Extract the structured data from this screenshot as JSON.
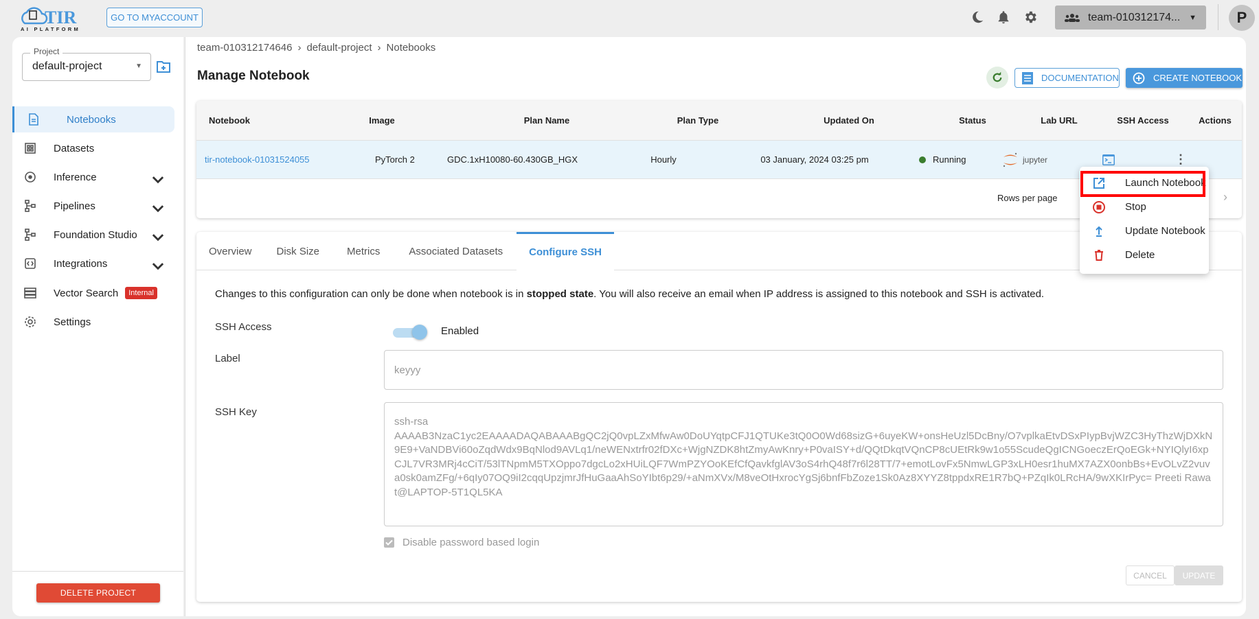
{
  "header": {
    "logo_text": "TIR",
    "logo_sub": "AI PLATFORM",
    "myaccount": "GO TO MYACCOUNT",
    "team": "team-010312174...",
    "avatar": "P",
    "icons": [
      "moon-icon",
      "bell-icon",
      "gear-icon"
    ]
  },
  "sidebar": {
    "project_label": "Project",
    "project": "default-project",
    "items": [
      {
        "label": "Notebooks",
        "icon": "notebook-icon"
      },
      {
        "label": "Datasets",
        "icon": "dataset-icon"
      },
      {
        "label": "Inference",
        "icon": "inference-icon"
      },
      {
        "label": "Pipelines",
        "icon": "pipeline-icon"
      },
      {
        "label": "Foundation Studio",
        "icon": "pipeline-icon"
      },
      {
        "label": "Integrations",
        "icon": "integration-icon"
      },
      {
        "label": "Vector Search",
        "icon": "storage-icon",
        "badge": "Internal"
      },
      {
        "label": "Settings",
        "icon": "gear-icon"
      }
    ],
    "delete_project": "DELETE PROJECT"
  },
  "breadcrumb": [
    "team-010312174646",
    "default-project",
    "Notebooks"
  ],
  "page": {
    "title": "Manage Notebook",
    "documentation": "DOCUMENTATION",
    "create": "CREATE NOTEBOOK"
  },
  "table": {
    "columns": [
      "Notebook",
      "Image",
      "Plan Name",
      "Plan Type",
      "Updated On",
      "Status",
      "Lab URL",
      "SSH Access",
      "Actions"
    ],
    "rows": [
      {
        "notebook": "tir-notebook-01031524055",
        "image": "PyTorch 2",
        "plan": "GDC.1xH10080-60.430GB_HGX",
        "type": "Hourly",
        "updated": "03 January, 2024 03:25 pm",
        "status": "Running",
        "lab": "jupyter"
      }
    ],
    "rows_per_page": "Rows per page"
  },
  "menu": {
    "items": [
      "Launch Notebook",
      "Stop",
      "Update Notebook",
      "Delete"
    ]
  },
  "tabs": [
    "Overview",
    "Disk Size",
    "Metrics",
    "Associated Datasets",
    "Configure SSH"
  ],
  "ssh": {
    "info_pre": "Changes to this configuration can only be done when notebook is in ",
    "info_bold": "stopped state",
    "info_post": ". You will also receive an email when IP address is assigned to this notebook and SSH is activated.",
    "access_label": "SSH Access",
    "access_state": "Enabled",
    "enabled": true,
    "label_label": "Label",
    "label_placeholder": "keyyy",
    "key_label": "SSH Key",
    "key_line1": "ssh-rsa",
    "key_body": "AAAAB3NzaC1yc2EAAAADAQABAAABgQC2jQ0vpLZxMfwAw0DoUYqtpCFJ1QTUKe3tQ0O0Wd68sizG+6uyeKW+onsHeUzl5DcBny/O7vplkaEtvDSxPIypBvjWZC3HyThzWjDXkN9E9+VaNDBVi60oZqdWdx9BqNlod9AVLq1/neWENxtrfr02fDXc+WjgNZDK8htZmyAwKnry+P0vaISY+d/QQtDkqtVQnCP8cUEtRk9w1o55ScudeQgICNGoeczErQoEGk+NYIQlyI6xpCJL7VR3MRj4cCiT/53lTNpmM5TXOppo7dgcLo2xHUiLQF7WmPZYOoKEfCfQavkfglAV3oS4rhQ48f7r6l28TT/7+emotLovFx5NmwLGP3xLH0esr1huMX7AZX0onbBs+EvOLvZ2vuva0sk0amZFg/+6qIy07OQ9iI2cqqUpzjmrJfHuGaaAhSoYIbt6p29/+aNmXVx/M8veOtHxrocYgSj6bnfFbZoze1Sk0Az8XYYZ8tppdxRE1R7bQ+PZqIk0LRcHA/9wXKIrPyc= Preeti Rawat@LAPTOP-5T1QL5KA",
    "disable_pw": "Disable password based login",
    "disable_pw_checked": true,
    "cancel": "CANCEL",
    "update": "UPDATE"
  },
  "colors": {
    "accent": "#3d8fd6",
    "danger": "#e04a35",
    "running": "#3a7d2e"
  }
}
